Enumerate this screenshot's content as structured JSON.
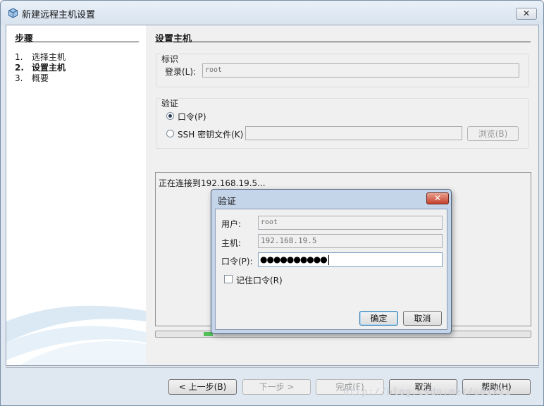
{
  "window": {
    "title": "新建远程主机设置",
    "icon": "cube-icon",
    "close_label": "✕"
  },
  "steps": {
    "title": "步骤",
    "items": [
      {
        "num": "1.",
        "label": "选择主机",
        "active": false
      },
      {
        "num": "2.",
        "label": "设置主机",
        "active": true
      },
      {
        "num": "3.",
        "label": "概要",
        "active": false
      }
    ]
  },
  "content": {
    "title": "设置主机",
    "identity": {
      "legend": "标识",
      "login_label": "登录(L):",
      "login_value": "root"
    },
    "auth": {
      "legend": "验证",
      "password_option": "口令(P)",
      "keyfile_option": "SSH 密钥文件(K)",
      "keyfile_value": "",
      "browse_label": "浏览(B)",
      "selected": "password"
    },
    "log_text": "正在连接到192.168.19.5...",
    "progress": 0.05
  },
  "buttons": {
    "back": "< 上一步(B)",
    "next": "下一步 >",
    "finish": "完成(F)",
    "cancel": "取消",
    "help": "帮助(H)"
  },
  "watermark": "http://blog.csdn.net/u01x21",
  "dialog": {
    "title": "验证",
    "close_label": "✕",
    "user_label": "用户:",
    "user_value": "root",
    "host_label": "主机:",
    "host_value": "192.168.19.5",
    "password_label": "口令(P):",
    "password_mask": "●●●●●●●●●●",
    "remember_label": "记住口令(R)",
    "remember_checked": false,
    "ok_label": "确定",
    "cancel_label": "取消"
  }
}
